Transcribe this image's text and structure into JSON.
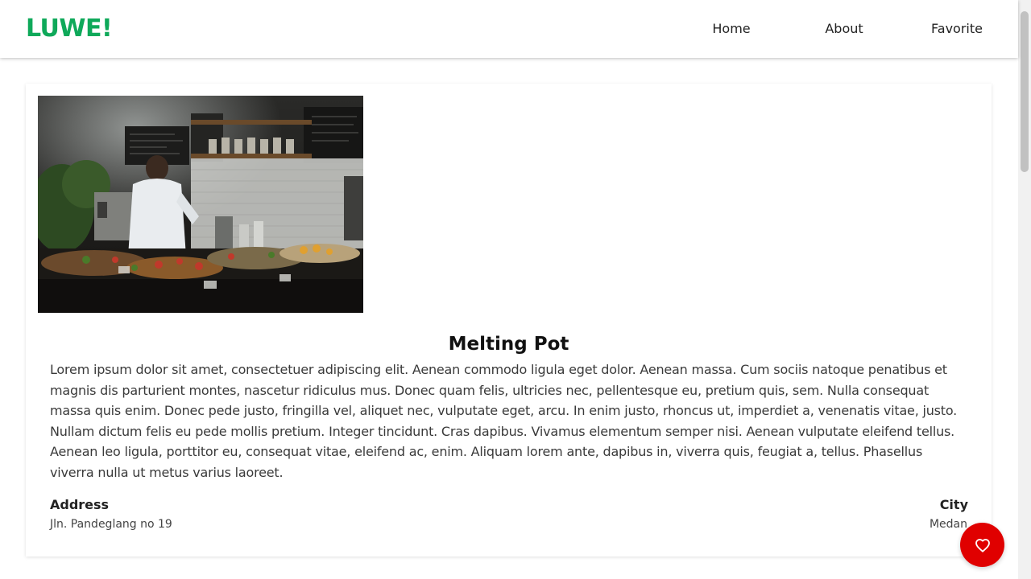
{
  "brand": "LUWE!",
  "nav": {
    "home": "Home",
    "about": "About",
    "favorite": "Favorite"
  },
  "restaurant": {
    "name": "Melting Pot",
    "description": "Lorem ipsum dolor sit amet, consectetuer adipiscing elit. Aenean commodo ligula eget dolor. Aenean massa. Cum sociis natoque penatibus et magnis dis parturient montes, nascetur ridiculus mus. Donec quam felis, ultricies nec, pellentesque eu, pretium quis, sem. Nulla consequat massa quis enim. Donec pede justo, fringilla vel, aliquet nec, vulputate eget, arcu. In enim justo, rhoncus ut, imperdiet a, venenatis vitae, justo. Nullam dictum felis eu pede mollis pretium. Integer tincidunt. Cras dapibus. Vivamus elementum semper nisi. Aenean vulputate eleifend tellus. Aenean leo ligula, porttitor eu, consequat vitae, eleifend ac, enim. Aliquam lorem ante, dapibus in, viverra quis, feugiat a, tellus. Phasellus viverra nulla ut metus varius laoreet.",
    "address_label": "Address",
    "address": "Jln. Pandeglang no 19",
    "city_label": "City",
    "city": "Medan"
  },
  "icons": {
    "favorite_button": "heart-icon"
  },
  "colors": {
    "brand": "#0fa95a",
    "favorite_button": "#e00000"
  }
}
